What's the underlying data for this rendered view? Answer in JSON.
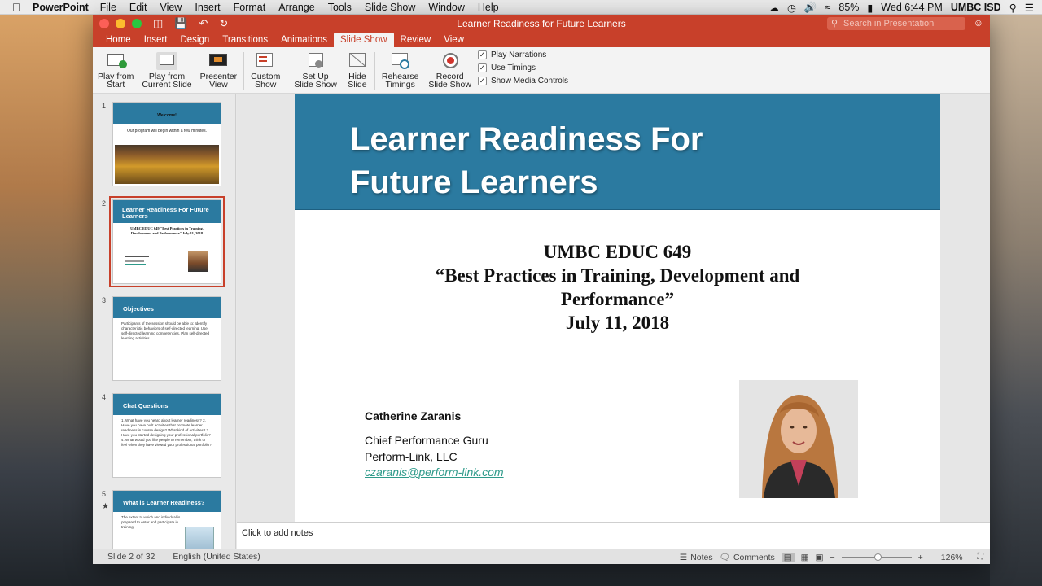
{
  "menubar": {
    "app": "PowerPoint",
    "menus": [
      "File",
      "Edit",
      "View",
      "Insert",
      "Format",
      "Arrange",
      "Tools",
      "Slide Show",
      "Window",
      "Help"
    ],
    "battery": "85%",
    "clock": "Wed 6:44 PM",
    "user": "UMBC ISD"
  },
  "window": {
    "title": "Learner Readiness for Future Learners",
    "search_placeholder": "Search in Presentation"
  },
  "ribbon": {
    "tabs": [
      "Home",
      "Insert",
      "Design",
      "Transitions",
      "Animations",
      "Slide Show",
      "Review",
      "View"
    ],
    "active_tab": "Slide Show",
    "buttons": [
      {
        "line1": "Play from",
        "line2": "Start"
      },
      {
        "line1": "Play from",
        "line2": "Current Slide"
      },
      {
        "line1": "Presenter",
        "line2": "View"
      },
      {
        "line1": "Custom",
        "line2": "Show"
      },
      {
        "line1": "Set Up",
        "line2": "Slide Show"
      },
      {
        "line1": "Hide",
        "line2": "Slide"
      },
      {
        "line1": "Rehearse",
        "line2": "Timings"
      },
      {
        "line1": "Record",
        "line2": "Slide Show"
      }
    ],
    "checkboxes": [
      {
        "label": "Play Narrations",
        "checked": true
      },
      {
        "label": "Use Timings",
        "checked": true
      },
      {
        "label": "Show Media Controls",
        "checked": true
      }
    ]
  },
  "thumbnails": [
    {
      "num": "1",
      "title": "Welcome!",
      "body": "Our program will begin within a few minutes."
    },
    {
      "num": "2",
      "title": "Learner Readiness For Future Learners",
      "body": "UMBC EDUC 649 \"Best Practices in Training, Development and Performance\" July 11, 2018"
    },
    {
      "num": "3",
      "title": "Objectives",
      "body": "Participants of the session should be able to: Identify characteristic behaviors of self-directed learning. Use self-directed learning competencies. Plan self-directed learning activities."
    },
    {
      "num": "4",
      "title": "Chat Questions",
      "body": "1. What have you heard about learner readiness? 2. Have you have built activities that promote learner readiness in course design? What kind of activities? 3. Have you started designing your professional portfolio? 4. What would you like people to remember, think or feel when they have viewed your professional portfolio?"
    },
    {
      "num": "5",
      "title": "What is Learner Readiness?",
      "body": "The extent to which and individual is prepared to enter and participate in training."
    }
  ],
  "slide": {
    "title_line1": "Learner Readiness For",
    "title_line2": "Future Learners",
    "course": "UMBC EDUC 649",
    "subtitle_line1": "“Best Practices in Training, Development and",
    "subtitle_line2": "Performance”",
    "date": "July 11, 2018",
    "presenter_name": "Catherine Zaranis",
    "presenter_role": "Chief Performance Guru",
    "presenter_org": "Perform-Link, LLC",
    "presenter_email": "czaranis@perform-link.com"
  },
  "notes_placeholder": "Click to add notes",
  "statusbar": {
    "slide_info": "Slide 2 of 32",
    "language": "English (United States)",
    "notes": "Notes",
    "comments": "Comments",
    "zoom": "126%"
  },
  "colors": {
    "accent": "#c8402a",
    "slide_header": "#2b7aa0"
  }
}
